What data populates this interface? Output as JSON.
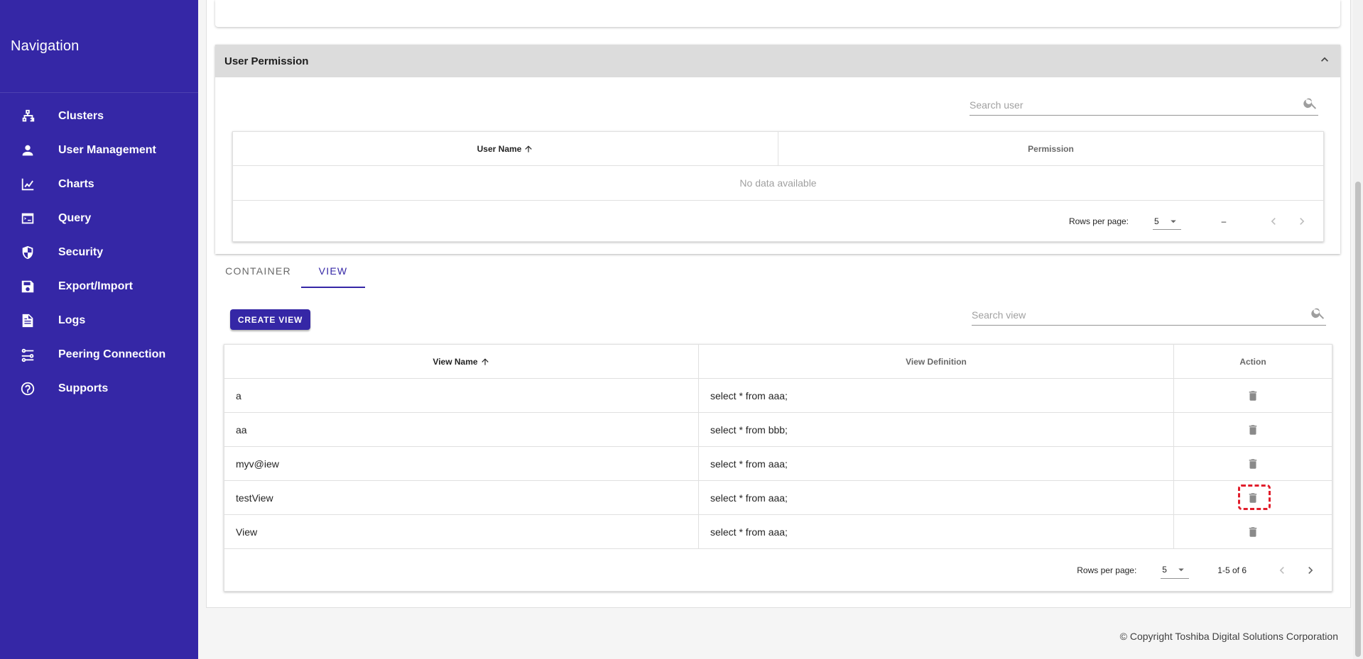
{
  "navigation": {
    "title": "Navigation",
    "items": [
      {
        "label": "Clusters",
        "icon": "sitemap-icon"
      },
      {
        "label": "User Management",
        "icon": "person-icon"
      },
      {
        "label": "Charts",
        "icon": "line-chart-icon"
      },
      {
        "label": "Query",
        "icon": "console-icon"
      },
      {
        "label": "Security",
        "icon": "shield-icon"
      },
      {
        "label": "Export/Import",
        "icon": "floppy-disk-icon"
      },
      {
        "label": "Logs",
        "icon": "document-icon"
      },
      {
        "label": "Peering Connection",
        "icon": "connection-icon"
      },
      {
        "label": "Supports",
        "icon": "help-circle-icon"
      }
    ]
  },
  "user_permission": {
    "title": "User Permission",
    "search_placeholder": "Search user",
    "columns": [
      "User Name",
      "Permission"
    ],
    "empty_text": "No data available",
    "rows_per_page_label": "Rows per page:",
    "rows_per_page": "5",
    "page_info": "–"
  },
  "tabs": [
    {
      "label": "CONTAINER",
      "active": false
    },
    {
      "label": "VIEW",
      "active": true
    }
  ],
  "views": {
    "create_label": "CREATE VIEW",
    "search_placeholder": "Search view",
    "columns": [
      "View Name",
      "View Definition",
      "Action"
    ],
    "rows": [
      {
        "name": "a",
        "definition": "select * from aaa;"
      },
      {
        "name": "aa",
        "definition": "select * from bbb;"
      },
      {
        "name": "myv@iew",
        "definition": "select * from aaa;"
      },
      {
        "name": "testView",
        "definition": "select * from aaa;"
      },
      {
        "name": "View",
        "definition": "select * from aaa;"
      }
    ],
    "rows_per_page_label": "Rows per page:",
    "rows_per_page": "5",
    "page_info": "1-5 of 6"
  },
  "footer": {
    "copyright": "© Copyright Toshiba Digital Solutions Corporation"
  },
  "colors": {
    "sidebar": "#3527a6",
    "accent": "#3527a6",
    "highlight": "#e11d2b"
  }
}
